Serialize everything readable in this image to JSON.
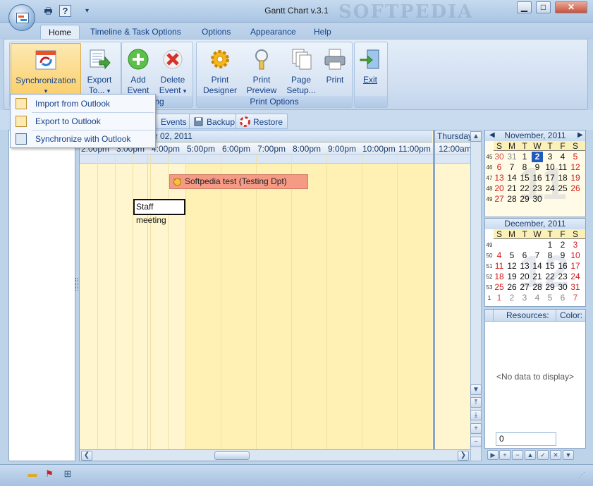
{
  "window": {
    "title": "Gantt Chart v.3.1",
    "watermark": "SOFTPEDIA",
    "minimize": "▁",
    "maximize": "□",
    "close": "✕"
  },
  "qat": {
    "print_icon": "🖶",
    "help_icon": "?",
    "dropdown_icon": "▾"
  },
  "tabs": [
    "Home",
    "Timeline & Task Options",
    "Options",
    "Appearance",
    "Help"
  ],
  "ribbon": {
    "sync": {
      "label": "Synchronization",
      "arrow": "▾"
    },
    "export": {
      "label1": "Export",
      "label2": "To...",
      "arrow": "▾"
    },
    "add_event": {
      "label1": "Add",
      "label2": "Event"
    },
    "delete_event": {
      "label1": "Delete",
      "label2": "Event",
      "arrow": "▾"
    },
    "editing_group_label": "ting",
    "print_designer": {
      "label1": "Print",
      "label2": "Designer"
    },
    "print_preview": {
      "label1": "Print",
      "label2": "Preview"
    },
    "page_setup": {
      "label1": "Page",
      "label2": "Setup..."
    },
    "print": {
      "label1": "Print"
    },
    "print_group_label": "Print Options",
    "exit": {
      "label1": "Exit"
    }
  },
  "dropdown": {
    "items": [
      "Import from Outlook",
      "Export to Outlook",
      "Synchronize with Outlook"
    ]
  },
  "toolbar": {
    "events": "Events",
    "backup": "Backup",
    "restore": "Restore"
  },
  "schedule": {
    "date_header": "er 02, 2011",
    "next_day_header": "Thursday",
    "hours": [
      "2:00pm",
      "3:00pm",
      "4:00pm",
      "5:00pm",
      "6:00pm",
      "7:00pm",
      "8:00pm",
      "9:00pm",
      "10:00pm",
      "11:00pm",
      "12:00am"
    ],
    "events": [
      {
        "title": "Softpedia test (Testing Dpt)",
        "color": "#f59a85"
      },
      {
        "title": "Staff meeting",
        "color": "#ffffff"
      }
    ],
    "scroll_left": "❮",
    "scroll_right": "❯"
  },
  "calendars": [
    {
      "month": "November, 2011",
      "big": "11",
      "dow": [
        "S",
        "M",
        "T",
        "W",
        "T",
        "F",
        "S"
      ],
      "weeks": [
        {
          "wk": "45",
          "days": [
            "30",
            "31",
            "1",
            "2",
            "3",
            "4",
            "5"
          ]
        },
        {
          "wk": "46",
          "days": [
            "6",
            "7",
            "8",
            "9",
            "10",
            "11",
            "12"
          ]
        },
        {
          "wk": "47",
          "days": [
            "13",
            "14",
            "15",
            "16",
            "17",
            "18",
            "19"
          ]
        },
        {
          "wk": "48",
          "days": [
            "20",
            "21",
            "22",
            "23",
            "24",
            "25",
            "26"
          ]
        },
        {
          "wk": "49",
          "days": [
            "27",
            "28",
            "29",
            "30",
            "",
            "",
            ""
          ]
        }
      ],
      "prev": "◀",
      "next": "▶"
    },
    {
      "month": "December, 2011",
      "big": "12",
      "dow": [
        "S",
        "M",
        "T",
        "W",
        "T",
        "F",
        "S"
      ],
      "weeks": [
        {
          "wk": "49",
          "days": [
            "",
            "",
            "",
            "",
            "1",
            "2",
            "3"
          ]
        },
        {
          "wk": "50",
          "days": [
            "4",
            "5",
            "6",
            "7",
            "8",
            "9",
            "10"
          ]
        },
        {
          "wk": "51",
          "days": [
            "11",
            "12",
            "13",
            "14",
            "15",
            "16",
            "17"
          ]
        },
        {
          "wk": "52",
          "days": [
            "18",
            "19",
            "20",
            "21",
            "22",
            "23",
            "24"
          ]
        },
        {
          "wk": "53",
          "days": [
            "25",
            "26",
            "27",
            "28",
            "29",
            "30",
            "31"
          ]
        },
        {
          "wk": "1",
          "days": [
            "1",
            "2",
            "3",
            "4",
            "5",
            "6",
            "7"
          ]
        }
      ]
    }
  ],
  "resources": {
    "col_resources": "Resources:",
    "col_color": "Color:",
    "empty": "<No data to display>",
    "position_value": "0"
  },
  "colors": {
    "accent": "#15428b",
    "today": "#1f5bbd",
    "weekend": "#d01818",
    "worktime": "#fff0b4"
  }
}
